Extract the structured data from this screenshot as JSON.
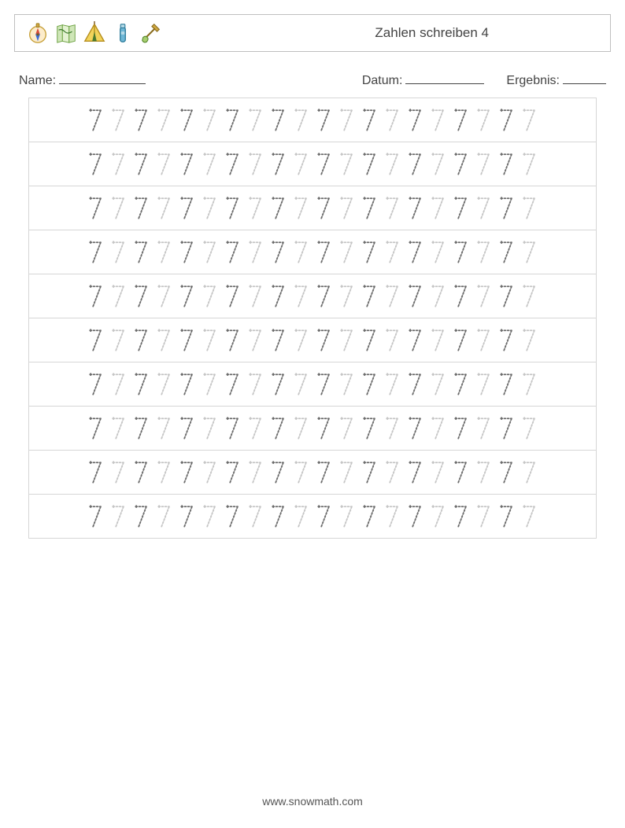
{
  "header": {
    "title": "Zahlen schreiben 4",
    "icons": [
      "compass",
      "map",
      "tent",
      "thermos",
      "shovel"
    ]
  },
  "meta": {
    "name_label": "Name:",
    "date_label": "Datum:",
    "result_label": "Ergebnis:"
  },
  "worksheet": {
    "digit": "7",
    "rows": 10,
    "cols": 20,
    "pattern": [
      "dark",
      "light"
    ]
  },
  "footer": {
    "url": "www.snowmath.com"
  }
}
